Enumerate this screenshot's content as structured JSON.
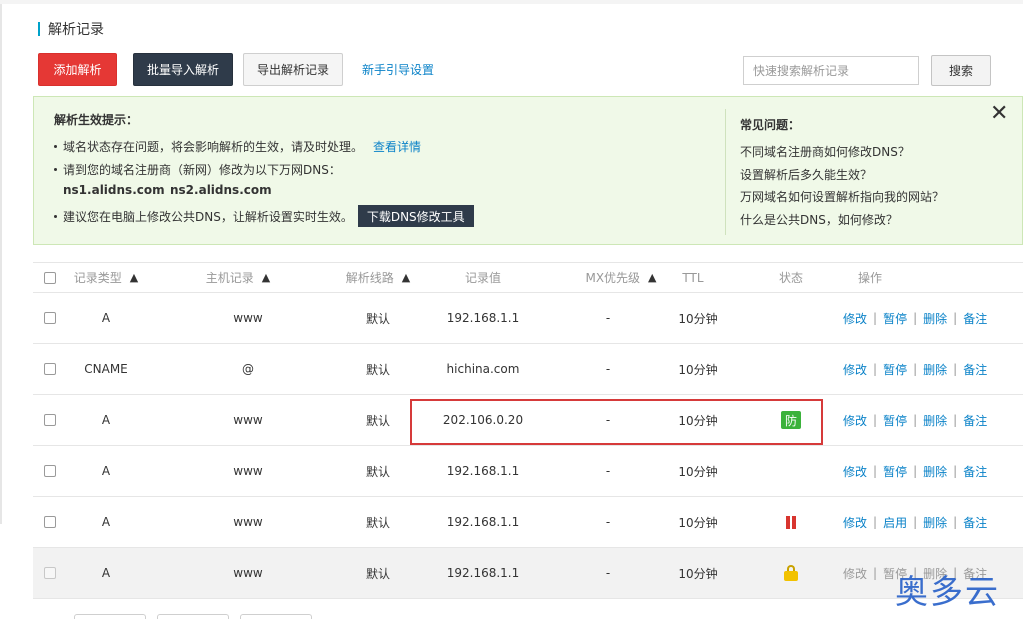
{
  "page": {
    "title": "解析记录"
  },
  "toolbar": {
    "add_label": "添加解析",
    "bulk_import_label": "批量导入解析",
    "export_label": "导出解析记录",
    "guide_label": "新手引导设置",
    "search_placeholder": "快速搜索解析记录",
    "search_label": "搜索"
  },
  "notice": {
    "title": "解析生效提示：",
    "line1": "域名状态存在问题，将会影响解析的生效，请及时处理。",
    "line1_link": "查看详情",
    "line2": "请到您的域名注册商（新网）修改为以下万网DNS：",
    "ns1": "ns1.alidns.com",
    "ns2": "ns2.alidns.com",
    "line3": "建议您在电脑上修改公共DNS，让解析设置实时生效。",
    "tool_button": "下载DNS修改工具",
    "faq_title": "常见问题：",
    "faq": [
      "不同域名注册商如何修改DNS？",
      "设置解析后多久能生效？",
      "万网域名如何设置解析指向我的网站？",
      "什么是公共DNS，如何修改？"
    ],
    "close_icon": "close-icon"
  },
  "table": {
    "headers": {
      "type": "记录类型",
      "host": "主机记录",
      "line": "解析线路",
      "value": "记录值",
      "mx": "MX优先级",
      "ttl": "TTL",
      "status": "状态",
      "ops": "操作"
    },
    "rows": [
      {
        "type": "A",
        "host": "www",
        "line": "默认",
        "value": "192.168.1.1",
        "mx": "-",
        "ttl": "10分钟",
        "status": "",
        "op1": "修改",
        "op2": "暂停",
        "op3": "删除",
        "op4": "备注"
      },
      {
        "type": "CNAME",
        "host": "@",
        "line": "默认",
        "value": "hichina.com",
        "mx": "-",
        "ttl": "10分钟",
        "status": "",
        "op1": "修改",
        "op2": "暂停",
        "op3": "删除",
        "op4": "备注"
      },
      {
        "type": "A",
        "host": "www",
        "line": "默认",
        "value": "202.106.0.20",
        "mx": "-",
        "ttl": "10分钟",
        "status": "防",
        "op1": "修改",
        "op2": "暂停",
        "op3": "删除",
        "op4": "备注"
      },
      {
        "type": "A",
        "host": "www",
        "line": "默认",
        "value": "192.168.1.1",
        "mx": "-",
        "ttl": "10分钟",
        "status": "",
        "op1": "修改",
        "op2": "暂停",
        "op3": "删除",
        "op4": "备注"
      },
      {
        "type": "A",
        "host": "www",
        "line": "默认",
        "value": "192.168.1.1",
        "mx": "-",
        "ttl": "10分钟",
        "status": "pause-icon",
        "op1": "修改",
        "op2": "启用",
        "op3": "删除",
        "op4": "备注"
      },
      {
        "type": "A",
        "host": "www",
        "line": "默认",
        "value": "192.168.1.1",
        "mx": "-",
        "ttl": "10分钟",
        "status": "lock-icon",
        "op1": "修改",
        "op2": "暂停",
        "op3": "删除",
        "op4": "备注"
      }
    ]
  },
  "watermark": "奥多云",
  "colors": {
    "accent_red": "#e53835",
    "dark_button": "#2f3b4a",
    "link_blue": "#0a82c8",
    "notice_bg": "#f0f9e8",
    "highlight_red": "#d63a3a"
  }
}
